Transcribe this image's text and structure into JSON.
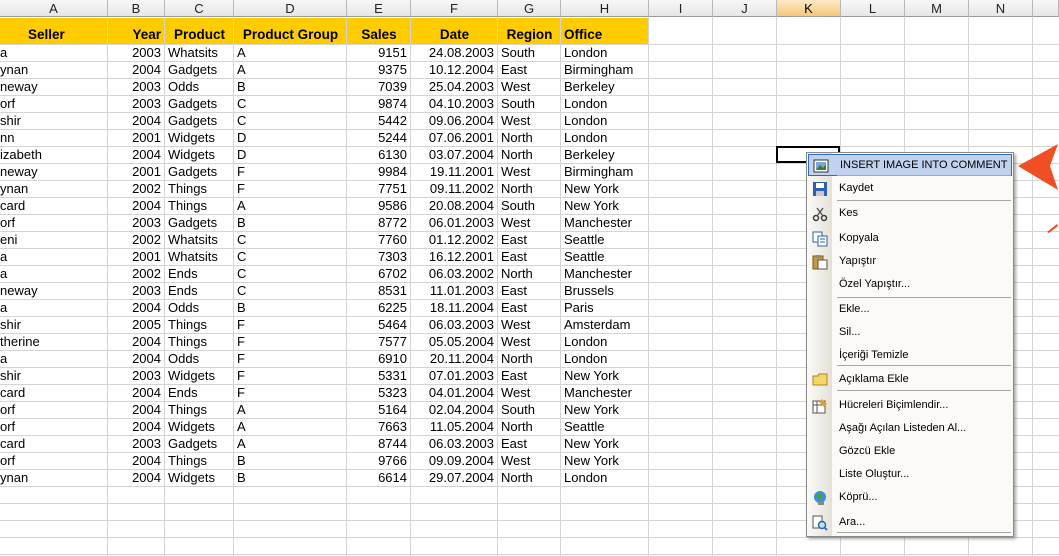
{
  "columns": [
    "A",
    "B",
    "C",
    "D",
    "E",
    "F",
    "G",
    "H",
    "I",
    "J",
    "K",
    "L",
    "M",
    "N"
  ],
  "selected_column": "K",
  "table": {
    "headers": [
      "Seller",
      "Year",
      "Product",
      "Product Group",
      "Sales",
      "Date",
      "Region",
      "Office"
    ],
    "rows": [
      [
        "a",
        "2003",
        "Whatsits",
        "A",
        "9151",
        "24.08.2003",
        "South",
        "London"
      ],
      [
        "ynan",
        "2004",
        "Gadgets",
        "A",
        "9375",
        "10.12.2004",
        "East",
        "Birmingham"
      ],
      [
        "neway",
        "2003",
        "Odds",
        "B",
        "7039",
        "25.04.2003",
        "West",
        "Berkeley"
      ],
      [
        "orf",
        "2003",
        "Gadgets",
        "C",
        "9874",
        "04.10.2003",
        "South",
        "London"
      ],
      [
        "shir",
        "2004",
        "Gadgets",
        "C",
        "5442",
        "09.06.2004",
        "West",
        "London"
      ],
      [
        "nn",
        "2001",
        "Widgets",
        "D",
        "5244",
        "07.06.2001",
        "North",
        "London"
      ],
      [
        "izabeth",
        "2004",
        "Widgets",
        "D",
        "6130",
        "03.07.2004",
        "North",
        "Berkeley"
      ],
      [
        "neway",
        "2001",
        "Gadgets",
        "F",
        "9984",
        "19.11.2001",
        "West",
        "Birmingham"
      ],
      [
        "ynan",
        "2002",
        "Things",
        "F",
        "7751",
        "09.11.2002",
        "North",
        "New York"
      ],
      [
        "card",
        "2004",
        "Things",
        "A",
        "9586",
        "20.08.2004",
        "South",
        "New York"
      ],
      [
        "orf",
        "2003",
        "Gadgets",
        "B",
        "8772",
        "06.01.2003",
        "West",
        "Manchester"
      ],
      [
        "eni",
        "2002",
        "Whatsits",
        "C",
        "7760",
        "01.12.2002",
        "East",
        "Seattle"
      ],
      [
        "a",
        "2001",
        "Whatsits",
        "C",
        "7303",
        "16.12.2001",
        "East",
        "Seattle"
      ],
      [
        "a",
        "2002",
        "Ends",
        "C",
        "6702",
        "06.03.2002",
        "North",
        "Manchester"
      ],
      [
        "neway",
        "2003",
        "Ends",
        "C",
        "8531",
        "11.01.2003",
        "East",
        "Brussels"
      ],
      [
        "a",
        "2004",
        "Odds",
        "B",
        "6225",
        "18.11.2004",
        "East",
        "Paris"
      ],
      [
        "shir",
        "2005",
        "Things",
        "F",
        "5464",
        "06.03.2003",
        "West",
        "Amsterdam"
      ],
      [
        "therine",
        "2004",
        "Things",
        "F",
        "7577",
        "05.05.2004",
        "West",
        "London"
      ],
      [
        "a",
        "2004",
        "Odds",
        "F",
        "6910",
        "20.11.2004",
        "North",
        "London"
      ],
      [
        "shir",
        "2003",
        "Widgets",
        "F",
        "5331",
        "07.01.2003",
        "East",
        "New York"
      ],
      [
        "card",
        "2004",
        "Ends",
        "F",
        "5323",
        "04.01.2004",
        "West",
        "Manchester"
      ],
      [
        "orf",
        "2004",
        "Things",
        "A",
        "5164",
        "02.04.2004",
        "South",
        "New York"
      ],
      [
        "orf",
        "2004",
        "Widgets",
        "A",
        "7663",
        "11.05.2004",
        "North",
        "Seattle"
      ],
      [
        "card",
        "2003",
        "Gadgets",
        "A",
        "8744",
        "06.03.2003",
        "East",
        "New York"
      ],
      [
        "orf",
        "2004",
        "Things",
        "B",
        "9766",
        "09.09.2004",
        "West",
        "New York"
      ],
      [
        "ynan",
        "2004",
        "Widgets",
        "B",
        "6614",
        "29.07.2004",
        "North",
        "London"
      ]
    ]
  },
  "context_menu": {
    "items": [
      {
        "label": "INSERT IMAGE INTO COMMENT",
        "icon": "image-icon"
      },
      {
        "label": "Kaydet",
        "icon": "save-icon"
      },
      {
        "label": "Kes",
        "icon": "scissors-icon"
      },
      {
        "label": "Kopyala",
        "icon": "copy-icon"
      },
      {
        "label": "Yapıştır",
        "icon": "paste-icon"
      },
      {
        "label": "Özel Yapıştır...",
        "icon": ""
      },
      {
        "label": "Ekle...",
        "icon": ""
      },
      {
        "label": "Sil...",
        "icon": ""
      },
      {
        "label": "İçeriği Temizle",
        "icon": ""
      },
      {
        "label": "Açıklama Ekle",
        "icon": "comment-icon"
      },
      {
        "label": "Hücreleri Biçimlendir...",
        "icon": "format-cells-icon"
      },
      {
        "label": "Aşağı Açılan Listeden Al...",
        "icon": ""
      },
      {
        "label": "Gözcü Ekle",
        "icon": ""
      },
      {
        "label": "Liste Oluştur...",
        "icon": ""
      },
      {
        "label": "Köprü...",
        "icon": "hyperlink-icon"
      },
      {
        "label": "Ara...",
        "icon": "research-icon"
      }
    ]
  },
  "colors": {
    "header_fill": "#ffcc00",
    "menu_highlight": "#c1d2ee",
    "arrow": "#f04e23"
  }
}
